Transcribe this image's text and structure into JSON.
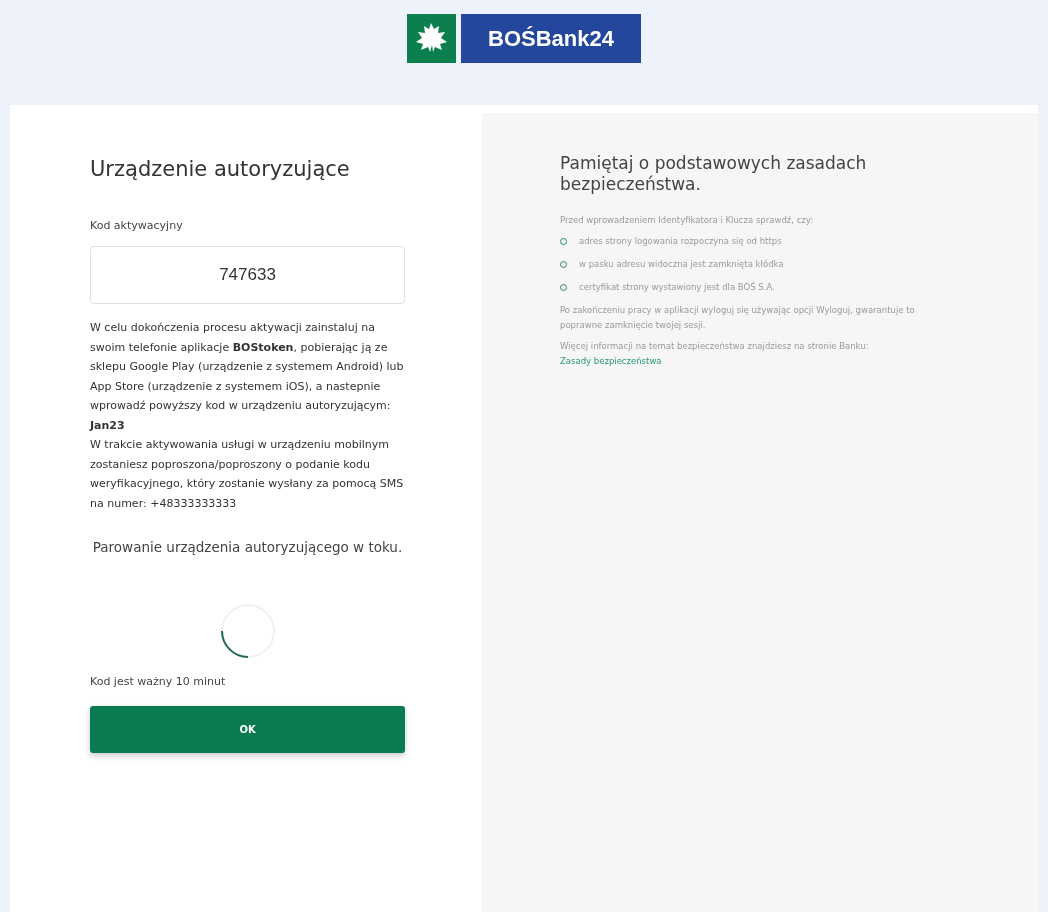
{
  "logo": {
    "text": "BOŚBank24"
  },
  "left": {
    "title": "Urządzenie autoryzujące",
    "field_label": "Kod aktywacyjny",
    "field_value": "747633",
    "instructions": "W celu dokończenia procesu aktywacji zainstaluj na swoim telefonie aplikacje **BOStoken**, pobierając ją ze sklepu Google Play (urządzenie z systemem Android) lub App Store (urządzenie z systemem iOS), a nastepnie wprowadź powyższy kod w urządzeniu autoryzującym:",
    "device_code": "Jan23",
    "sms_info": "W trakcie aktywowania usługi w urządzeniu mobilnym zostaniesz poproszona/poproszony o podanie kodu weryfikacyjnego, który zostanie wysłany za pomocą SMS na numer: +48333333333",
    "status": "Parowanie urządzenia autoryzującego w toku.",
    "validity": "Kod jest ważny 10 minut",
    "button": "OK"
  },
  "right": {
    "title": "Pamiętaj o podstawowych zasadach bezpieczeństwa.",
    "intro": "Przed wprowadzeniem Identyfikatora i Klucza sprawdź, czy:",
    "checklist": [
      "adres strony logowania rozpoczyna się od https",
      "w pasku adresu widoczna jest zamknięta kłódka",
      "certyfikat strony wystawiony jest dla BOŚ S.A."
    ],
    "logout_note": "Po zakończeniu pracy w aplikacji wyloguj się używając opcji Wyloguj, gwarantuje to poprawne zamknięcie twojej sesji.",
    "more_info": "Więcej informacji na temat bezpieczeństwa znajdziesz na stronie Banku:",
    "link": "Zasady bezpieczeństwa"
  }
}
